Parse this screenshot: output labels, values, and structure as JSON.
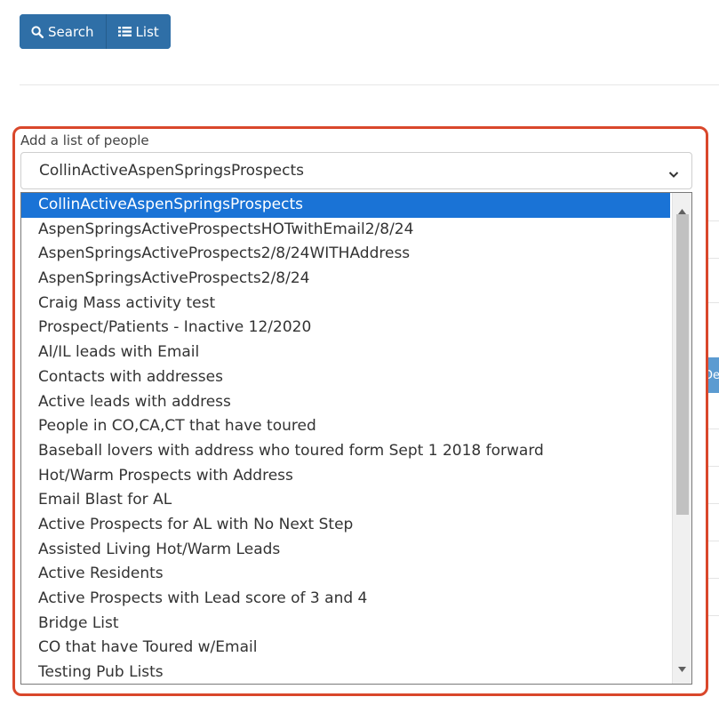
{
  "toolbar": {
    "search_label": "Search",
    "list_label": "List"
  },
  "background": {
    "partial_button_label": "De"
  },
  "field": {
    "label": "Add a list of people",
    "selected_value": "CollinActiveAspenSpringsProspects"
  },
  "dropdown": {
    "options": [
      "CollinActiveAspenSpringsProspects",
      "AspenSpringsActiveProspectsHOTwithEmail2/8/24",
      "AspenSpringsActiveProspects2/8/24WITHAddress",
      "AspenSpringsActiveProspects2/8/24",
      "Craig Mass activity test",
      "Prospect/Patients - Inactive 12/2020",
      "Al/IL leads with Email",
      "Contacts with addresses",
      "Active leads with address",
      "People in CO,CA,CT that have toured",
      "Baseball lovers with address who toured form Sept 1 2018 forward",
      "Hot/Warm Prospects with Address",
      "Email Blast for AL",
      "Active Prospects for AL with No Next Step",
      "Assisted Living Hot/Warm Leads",
      "Active Residents",
      "Active Prospects with Lead score of 3 and 4",
      "Bridge List",
      "CO that have Toured w/Email",
      "Testing Pub Lists"
    ],
    "selected_index": 0
  },
  "colors": {
    "primary_button": "#2f6fa7",
    "highlight_border": "#d9472b",
    "selected_option": "#1a73d6"
  }
}
